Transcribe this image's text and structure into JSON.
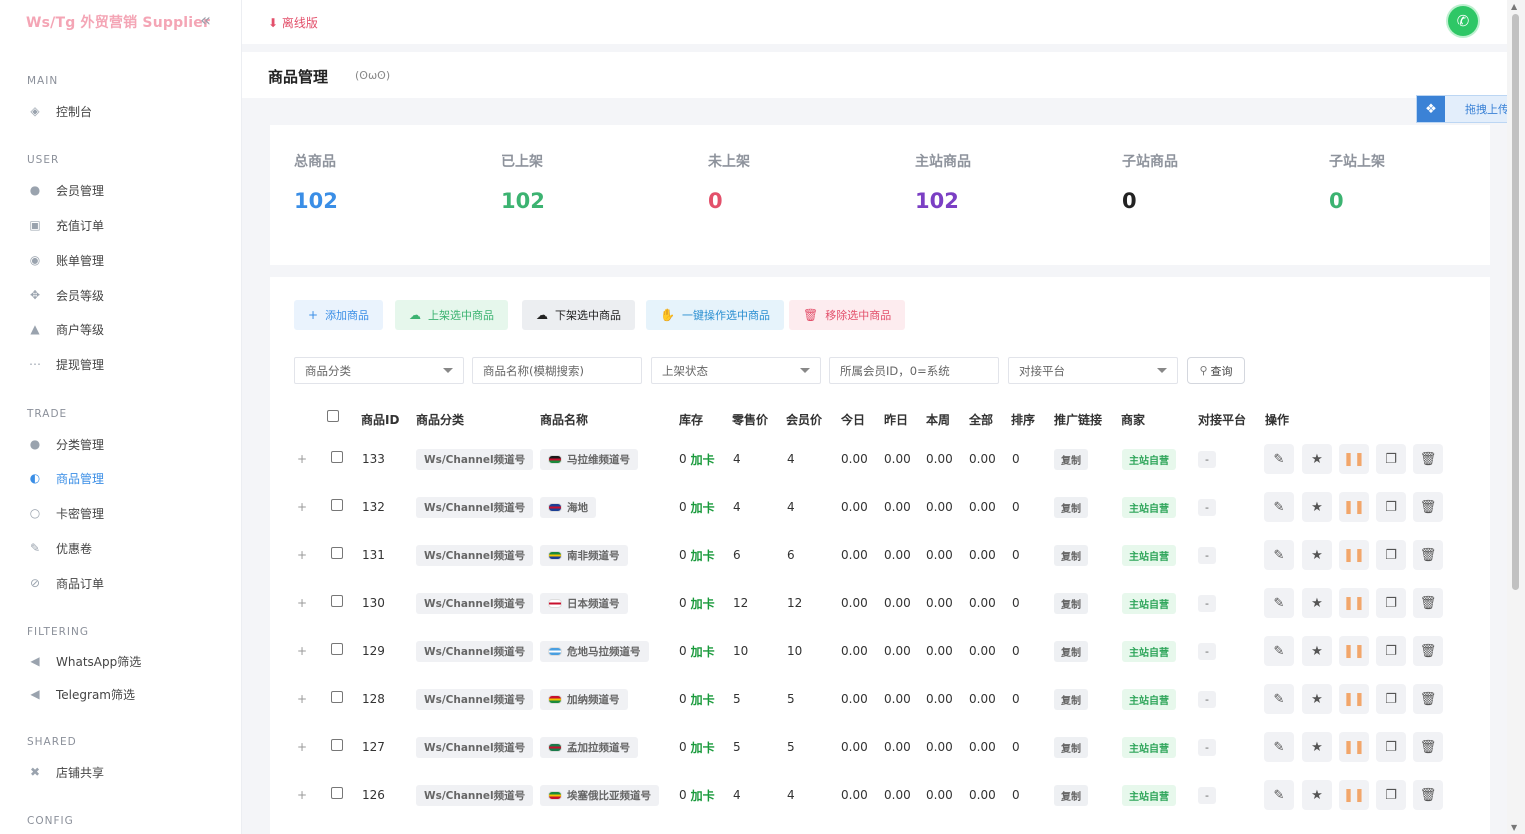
{
  "brand": "Ws/Tg 外贸营销 Supplier",
  "topbar": {
    "offline": "离线版"
  },
  "page": {
    "title": "商品管理",
    "subtitle": "(ʘωʘ)"
  },
  "upload": {
    "label": "拖拽上传"
  },
  "sidebar": {
    "sections": [
      {
        "title": "MAIN",
        "items": [
          {
            "label": "控制台",
            "icon": "dashboard-icon"
          }
        ]
      },
      {
        "title": "USER",
        "items": [
          {
            "label": "会员管理",
            "icon": "user-icon"
          },
          {
            "label": "充值订单",
            "icon": "recharge-icon"
          },
          {
            "label": "账单管理",
            "icon": "bill-icon"
          },
          {
            "label": "会员等级",
            "icon": "level-icon"
          },
          {
            "label": "商户等级",
            "icon": "merchant-level-icon"
          },
          {
            "label": "提现管理",
            "icon": "withdraw-icon"
          }
        ]
      },
      {
        "title": "TRADE",
        "items": [
          {
            "label": "分类管理",
            "icon": "category-icon"
          },
          {
            "label": "商品管理",
            "icon": "goods-icon",
            "active": true
          },
          {
            "label": "卡密管理",
            "icon": "card-icon"
          },
          {
            "label": "优惠卷",
            "icon": "coupon-icon"
          },
          {
            "label": "商品订单",
            "icon": "order-icon"
          }
        ]
      },
      {
        "title": "FILTERING",
        "items": [
          {
            "label": "WhatsApp筛选",
            "icon": "whatsapp-icon"
          },
          {
            "label": "Telegram筛选",
            "icon": "telegram-icon"
          }
        ]
      },
      {
        "title": "SHARED",
        "items": [
          {
            "label": "店铺共享",
            "icon": "share-icon"
          }
        ]
      },
      {
        "title": "CONFIG",
        "items": []
      }
    ]
  },
  "stats": [
    {
      "label": "总商品",
      "value": "102",
      "color": "#3a8ee6"
    },
    {
      "label": "已上架",
      "value": "102",
      "color": "#3cb371"
    },
    {
      "label": "未上架",
      "value": "0",
      "color": "#e3506b"
    },
    {
      "label": "主站商品",
      "value": "102",
      "color": "#7b3fc4"
    },
    {
      "label": "子站商品",
      "value": "0",
      "color": "#222222"
    },
    {
      "label": "子站上架",
      "value": "0",
      "color": "#3cb371"
    }
  ],
  "toolbar": {
    "add": "添加商品",
    "shelve": "上架选中商品",
    "unshelve": "下架选中商品",
    "batch": "一键操作选中商品",
    "remove": "移除选中商品"
  },
  "filters": {
    "category": "商品分类",
    "name": "商品名称(模糊搜索)",
    "status": "上架状态",
    "member": "所属会员ID，0=系统",
    "platform": "对接平台",
    "query": "查询"
  },
  "columns": [
    "商品ID",
    "商品分类",
    "商品名称",
    "库存",
    "零售价",
    "会员价",
    "今日",
    "昨日",
    "本周",
    "全部",
    "排序",
    "推广链接",
    "商家",
    "对接平台",
    "操作"
  ],
  "rows": [
    {
      "id": "133",
      "category": "Ws/Channel频道号",
      "name": "马拉维频道号",
      "flag": [
        "#1a1a1a",
        "#c8102e",
        "#1a8a3c"
      ],
      "stock": "0",
      "restock": "加卡",
      "retail": "4",
      "member": "4",
      "today": "0.00",
      "yesterday": "0.00",
      "week": "0.00",
      "all": "0.00",
      "sort": "0",
      "promo": "复制",
      "merchant": "主站自营",
      "platform": "-"
    },
    {
      "id": "132",
      "category": "Ws/Channel频道号",
      "name": "海地",
      "flag": [
        "#1c3f94",
        "#c8102e",
        "#1c3f94"
      ],
      "stock": "0",
      "restock": "加卡",
      "retail": "4",
      "member": "4",
      "today": "0.00",
      "yesterday": "0.00",
      "week": "0.00",
      "all": "0.00",
      "sort": "0",
      "promo": "复制",
      "merchant": "主站自营",
      "platform": "-"
    },
    {
      "id": "131",
      "category": "Ws/Channel频道号",
      "name": "南非频道号",
      "flag": [
        "#1a8a3c",
        "#f2c200",
        "#1c3f94"
      ],
      "stock": "0",
      "restock": "加卡",
      "retail": "6",
      "member": "6",
      "today": "0.00",
      "yesterday": "0.00",
      "week": "0.00",
      "all": "0.00",
      "sort": "0",
      "promo": "复制",
      "merchant": "主站自营",
      "platform": "-"
    },
    {
      "id": "130",
      "category": "Ws/Channel频道号",
      "name": "日本频道号",
      "flag": [
        "#ffffff",
        "#c8102e",
        "#ffffff"
      ],
      "stock": "0",
      "restock": "加卡",
      "retail": "12",
      "member": "12",
      "today": "0.00",
      "yesterday": "0.00",
      "week": "0.00",
      "all": "0.00",
      "sort": "0",
      "promo": "复制",
      "merchant": "主站自营",
      "platform": "-"
    },
    {
      "id": "129",
      "category": "Ws/Channel频道号",
      "name": "危地马拉频道号",
      "flag": [
        "#4a9fe0",
        "#ffffff",
        "#4a9fe0"
      ],
      "stock": "0",
      "restock": "加卡",
      "retail": "10",
      "member": "10",
      "today": "0.00",
      "yesterday": "0.00",
      "week": "0.00",
      "all": "0.00",
      "sort": "0",
      "promo": "复制",
      "merchant": "主站自营",
      "platform": "-"
    },
    {
      "id": "128",
      "category": "Ws/Channel频道号",
      "name": "加纳频道号",
      "flag": [
        "#c8102e",
        "#f2c200",
        "#1a8a3c"
      ],
      "stock": "0",
      "restock": "加卡",
      "retail": "5",
      "member": "5",
      "today": "0.00",
      "yesterday": "0.00",
      "week": "0.00",
      "all": "0.00",
      "sort": "0",
      "promo": "复制",
      "merchant": "主站自营",
      "platform": "-"
    },
    {
      "id": "127",
      "category": "Ws/Channel频道号",
      "name": "孟加拉频道号",
      "flag": [
        "#1a7a4a",
        "#c8102e",
        "#1a7a4a"
      ],
      "stock": "0",
      "restock": "加卡",
      "retail": "5",
      "member": "5",
      "today": "0.00",
      "yesterday": "0.00",
      "week": "0.00",
      "all": "0.00",
      "sort": "0",
      "promo": "复制",
      "merchant": "主站自营",
      "platform": "-"
    },
    {
      "id": "126",
      "category": "Ws/Channel频道号",
      "name": "埃塞俄比亚频道号",
      "flag": [
        "#1a8a3c",
        "#f2c200",
        "#c8102e"
      ],
      "stock": "0",
      "restock": "加卡",
      "retail": "4",
      "member": "4",
      "today": "0.00",
      "yesterday": "0.00",
      "week": "0.00",
      "all": "0.00",
      "sort": "0",
      "promo": "复制",
      "merchant": "主站自营",
      "platform": "-"
    }
  ]
}
